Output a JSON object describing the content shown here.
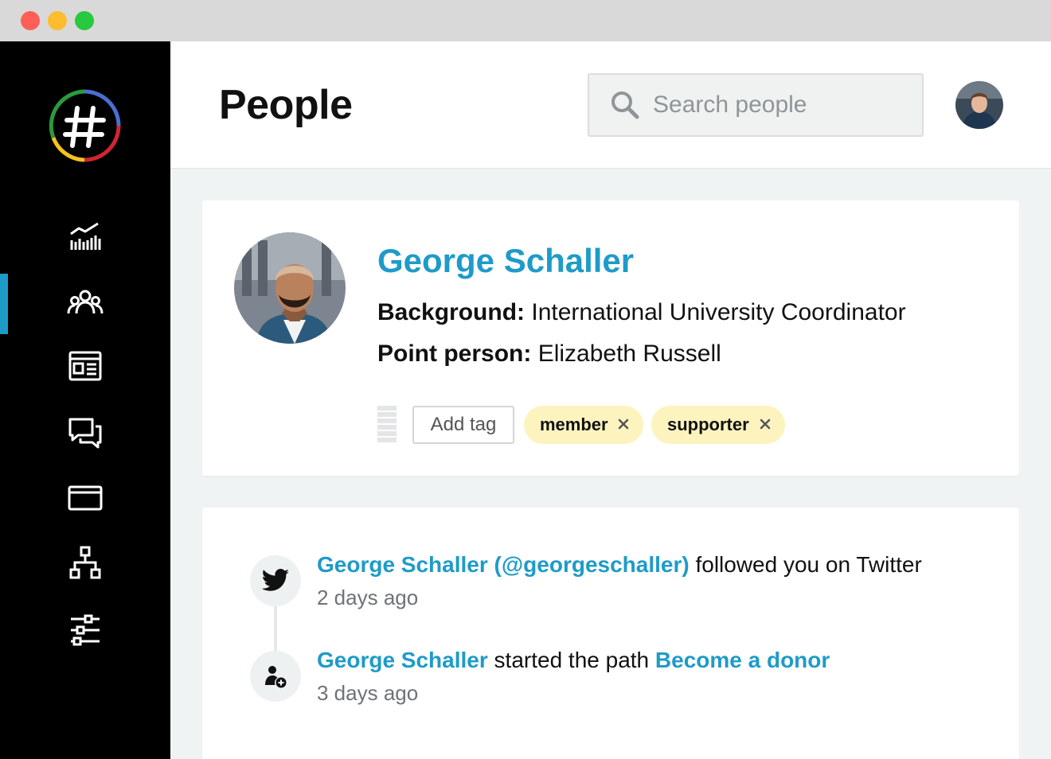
{
  "window": {
    "controls": [
      "close",
      "minimize",
      "maximize"
    ]
  },
  "sidebar": {
    "logo_icon": "hashtag-logo",
    "active_index": 1,
    "items": [
      {
        "icon": "analytics-icon"
      },
      {
        "icon": "people-icon"
      },
      {
        "icon": "news-icon"
      },
      {
        "icon": "conversations-icon"
      },
      {
        "icon": "browser-window-icon"
      },
      {
        "icon": "org-chart-icon"
      },
      {
        "icon": "settings-sliders-icon"
      }
    ]
  },
  "header": {
    "title": "People",
    "search": {
      "placeholder": "Search people",
      "value": ""
    }
  },
  "profile": {
    "name": "George Schaller",
    "background_label": "Background:",
    "background_value": "International University Coordinator",
    "point_person_label": "Point person:",
    "point_person_value": "Elizabeth Russell",
    "add_tag_label": "Add tag",
    "tags": [
      "member",
      "supporter"
    ]
  },
  "activity": {
    "events": [
      {
        "icon": "twitter-icon",
        "actor": "George Schaller (@georgeschaller)",
        "text": " followed you on Twitter",
        "time": "2 days ago"
      },
      {
        "icon": "add-person-icon",
        "actor": "George Schaller",
        "text": " started the path ",
        "target": "Become a donor",
        "time": "3 days ago"
      }
    ]
  },
  "colors": {
    "accent": "#1e9bc8",
    "tag_bg": "#fdf3bf",
    "sidebar_bg": "#000000",
    "page_bg": "#f0f3f4"
  }
}
